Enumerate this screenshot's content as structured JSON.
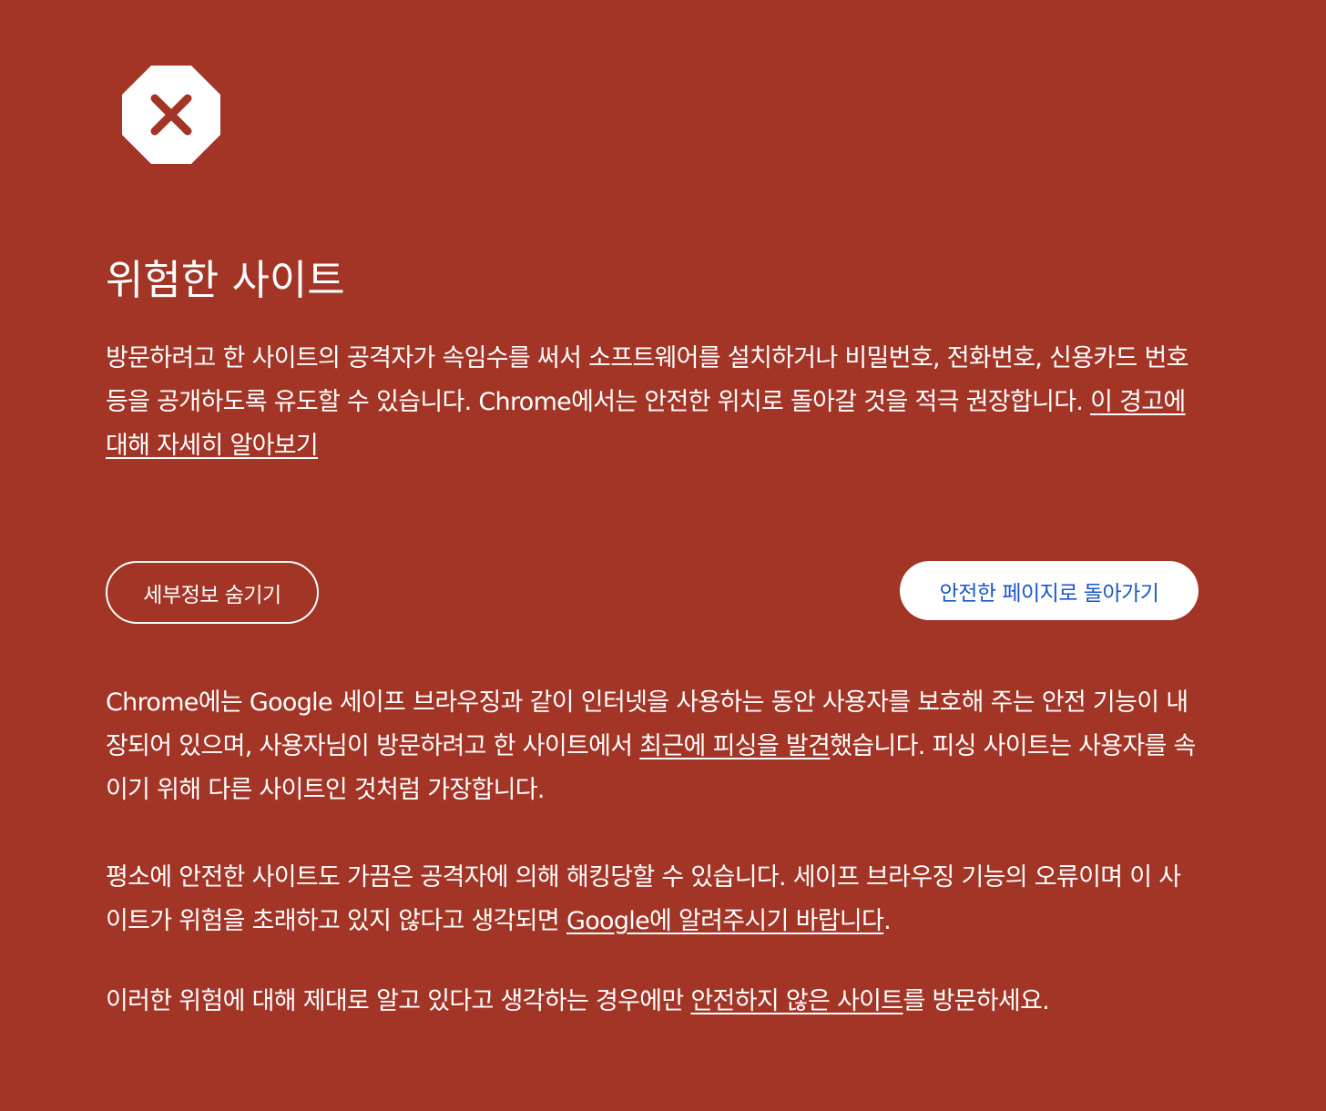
{
  "icon": {
    "name": "danger-stop-icon"
  },
  "title": "위험한 사이트",
  "intro": {
    "text": "방문하려고 한 사이트의 공격자가 속임수를 써서 소프트웨어를 설치하거나 비밀번호, 전화번호, 신용카드 번호 등을 공개하도록 유도할 수 있습니다. Chrome에서는 안전한 위치로 돌아갈 것을 적극 권장합니다. ",
    "learn_more_link": "이 경고에 대해 자세히 알아보기"
  },
  "buttons": {
    "hide_details": "세부정보 숨기기",
    "back_to_safety": "안전한 페이지로 돌아가기"
  },
  "details": {
    "p1_before": "Chrome에는 Google 세이프 브라우징과 같이 인터넷을 사용하는 동안 사용자를 보호해 주는 안전 기능이 내장되어 있으며, 사용자님이 방문하려고 한 사이트에서 ",
    "p1_link": "최근에 피싱을 발견",
    "p1_after": "했습니다. 피싱 사이트는 사용자를 속이기 위해 다른 사이트인 것처럼 가장합니다.",
    "p2_before": "평소에 안전한 사이트도 가끔은 공격자에 의해 해킹당할 수 있습니다. 세이프 브라우징 기능의 오류이며 이 사이트가 위험을 초래하고 있지 않다고 생각되면 ",
    "p2_link": "Google에 알려주시기 바랍니다",
    "p2_after": ".",
    "p3_before": "이러한 위험에 대해 제대로 알고 있다고 생각하는 경우에만 ",
    "p3_link": "안전하지 않은 사이트",
    "p3_after": "를 방문하세요."
  },
  "colors": {
    "background": "#a33527",
    "text": "#ffffff",
    "primary_button_text": "#1a56c9"
  }
}
